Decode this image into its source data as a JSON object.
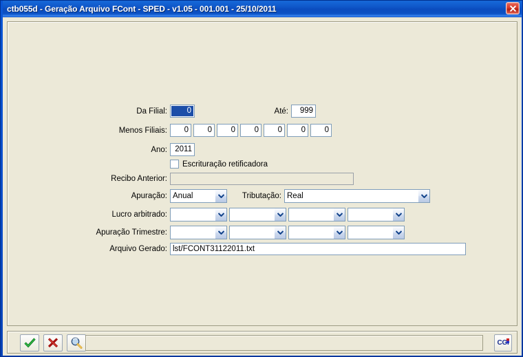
{
  "window": {
    "title": "ctb055d - Geração Arquivo FCont - SPED - v1.05 - 001.001 - 25/10/2011",
    "close_icon": "close-icon",
    "accent_color": "#0b4ecb",
    "client_bg": "#ece9d8"
  },
  "form": {
    "da_filial": {
      "label": "Da Filial:",
      "value": "0",
      "selected": true
    },
    "ate": {
      "label": "Até:",
      "value": "999"
    },
    "menos_filiais": {
      "label": "Menos Filiais:",
      "values": [
        "0",
        "0",
        "0",
        "0",
        "0",
        "0",
        "0"
      ]
    },
    "ano": {
      "label": "Ano:",
      "value": "2011"
    },
    "escrituracao": {
      "label": "Escrituração retificadora",
      "checked": false
    },
    "recibo_anterior": {
      "label": "Recibo Anterior:",
      "value": "",
      "placeholder": "",
      "disabled": true
    },
    "apuracao": {
      "label": "Apuração:",
      "value": "Anual"
    },
    "tributacao": {
      "label": "Tributação:",
      "value": "Real"
    },
    "lucro_arbitrado": {
      "label": "Lucro arbitrado:",
      "values": [
        "",
        "",
        "",
        ""
      ]
    },
    "apuracao_trimestre": {
      "label": "Apuração Trimestre:",
      "values": [
        "",
        "",
        "",
        ""
      ]
    },
    "arquivo_gerado": {
      "label": "Arquivo Gerado:",
      "value": "lst/FCONT31122011.txt"
    }
  },
  "toolbar": {
    "confirm_icon": "checkmark-icon",
    "cancel_icon": "cross-icon",
    "search_icon": "magnifier-icon",
    "status_text": "",
    "logo_text": "CGi"
  }
}
